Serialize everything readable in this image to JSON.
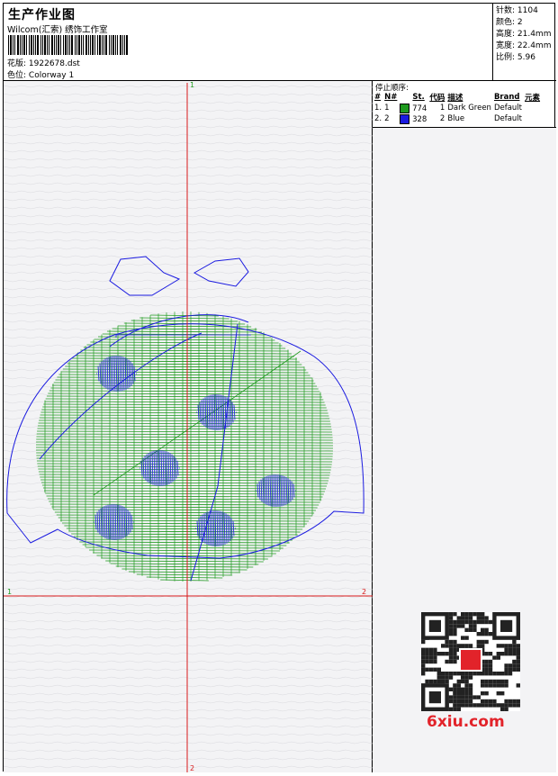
{
  "header": {
    "title": "生产作业图",
    "studio": "Wilcom(汇索) 绣饰工作室",
    "design_label": "花版:",
    "design_value": "1922678.dst",
    "colorway_label": "色位:",
    "colorway_value": "Colorway 1"
  },
  "stats": {
    "stitches": "针数: 1104",
    "colors": "颜色: 2",
    "height": "高度: 21.4mm",
    "width": "宽度: 22.4mm",
    "scale": "比例: 5.96"
  },
  "stop_sequence": {
    "title": "停止顺序:",
    "headers": [
      "#",
      "N#",
      "St.",
      "代码",
      "描述",
      "Brand",
      "元素"
    ],
    "rows": [
      {
        "num": "1.",
        "needle": "1",
        "stitches": "774",
        "code": "1",
        "desc": "Dark Green",
        "brand": "Default",
        "color": "#1e9a1e"
      },
      {
        "num": "2.",
        "needle": "2",
        "stitches": "328",
        "code": "2",
        "desc": "Blue",
        "brand": "Default",
        "color": "#1a1ae0"
      }
    ]
  },
  "axis_labels": {
    "top": "1",
    "left": "1",
    "right": "2",
    "bottom": "2"
  },
  "watermark": {
    "site": "6xiu.com"
  },
  "colors": {
    "green": "#1e9a1e",
    "blue": "#1a1ae0",
    "axis": "#d81a1a"
  }
}
